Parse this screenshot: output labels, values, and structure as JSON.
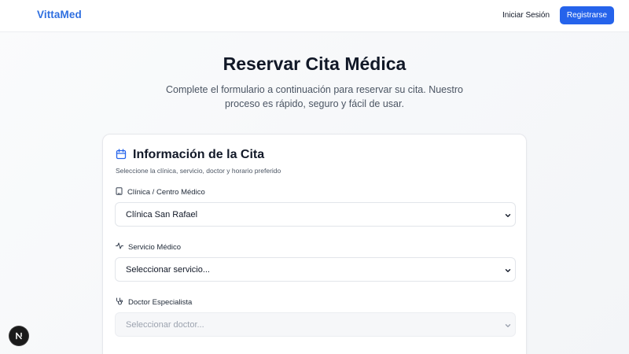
{
  "header": {
    "brand": "VittaMed",
    "login_label": "Iniciar Sesión",
    "register_label": "Registrarse"
  },
  "hero": {
    "title": "Reservar Cita Médica",
    "description": "Complete el formulario a continuación para reservar su cita. Nuestro proceso es rápido, seguro y fácil de usar."
  },
  "card": {
    "title": "Información de la Cita",
    "subtitle": "Seleccione la clínica, servicio, doctor y horario preferido",
    "fields": [
      {
        "label": "Clínica / Centro Médico",
        "value": "Clínica San Rafael",
        "icon": "building-icon",
        "disabled": false
      },
      {
        "label": "Servicio Médico",
        "value": "Seleccionar servicio...",
        "icon": "activity-icon",
        "disabled": false
      },
      {
        "label": "Doctor Especialista",
        "value": "Seleccionar doctor...",
        "icon": "stethoscope-icon",
        "disabled": true
      }
    ]
  },
  "colors": {
    "brand": "#2f6fe0",
    "primary_button": "#2563eb",
    "dev_badge": "#1a1a1a"
  }
}
